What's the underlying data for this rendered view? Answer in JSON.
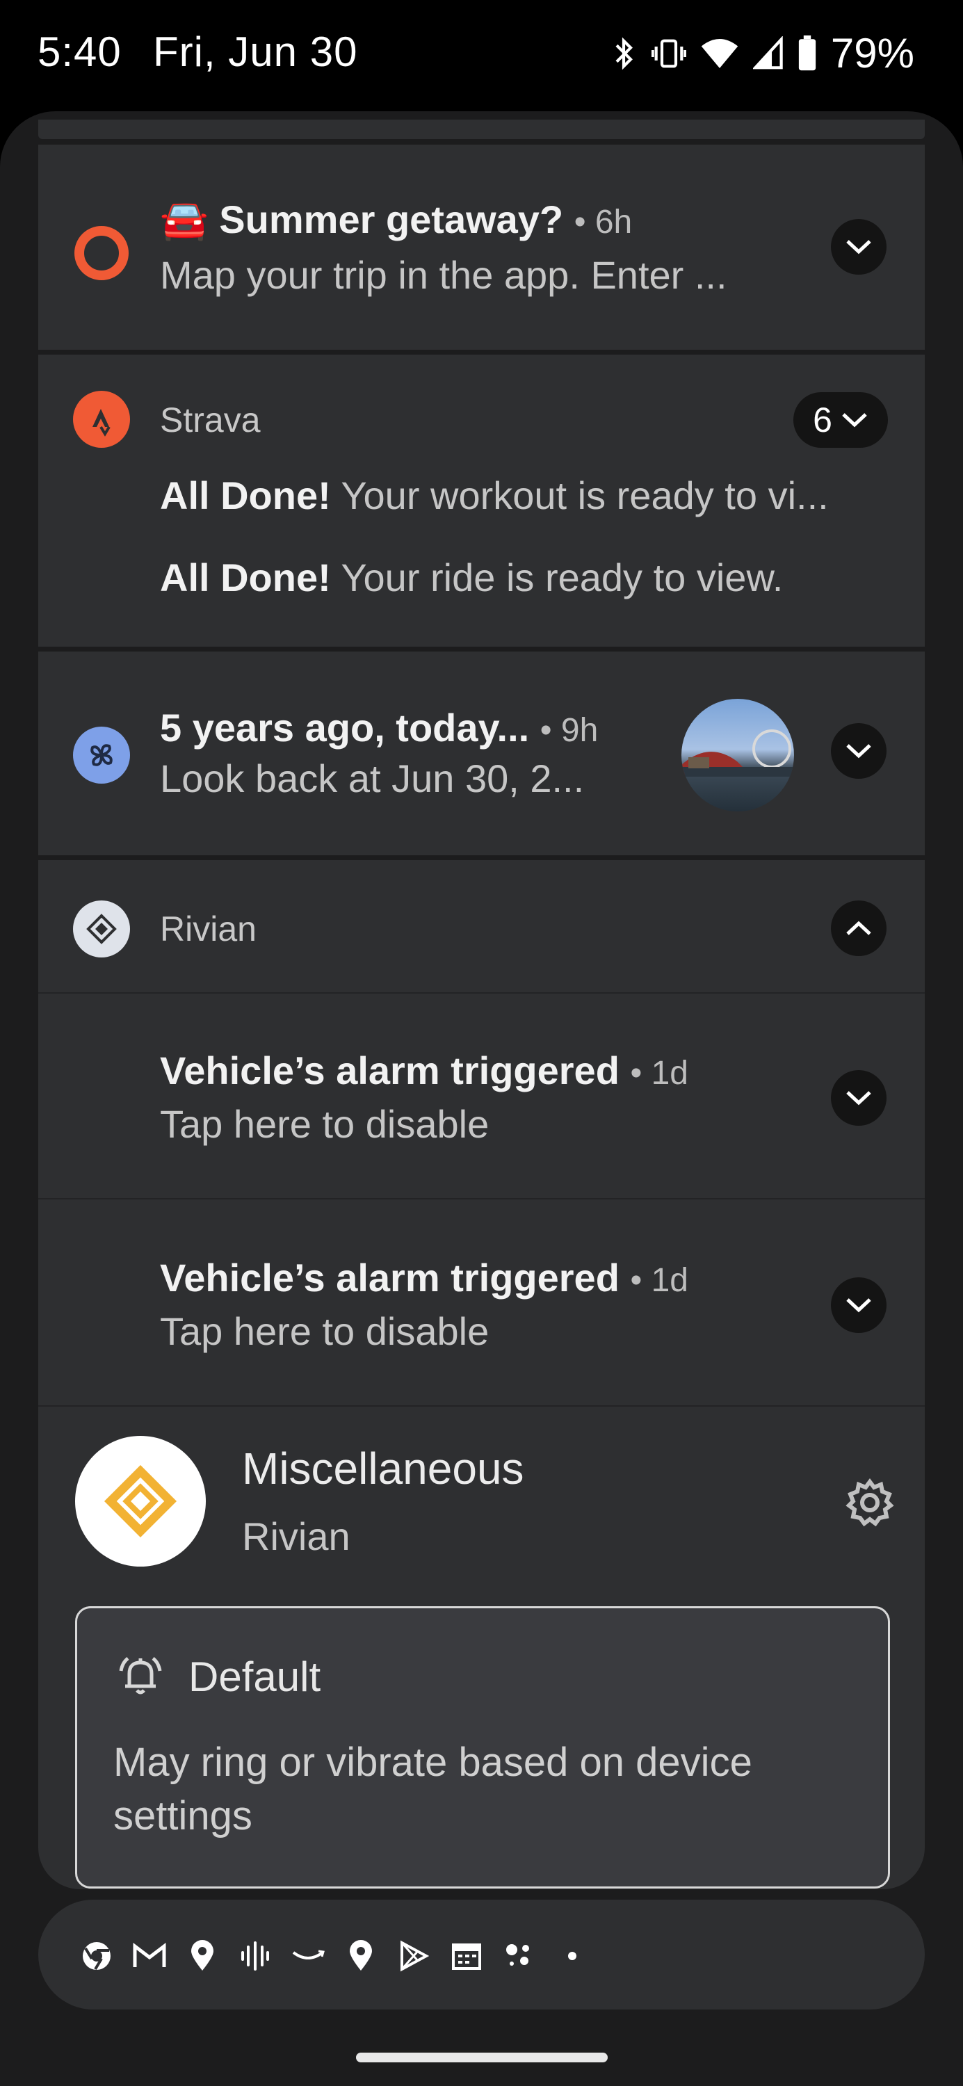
{
  "status_bar": {
    "time": "5:40",
    "date": "Fri, Jun 30",
    "battery": "79%",
    "icons": [
      "bluetooth-icon",
      "vibrate-icon",
      "wifi-icon",
      "signal-icon",
      "battery-icon"
    ]
  },
  "notifications": {
    "getaway": {
      "emoji": "🚘",
      "title": "Summer getaway?",
      "time": "• 6h",
      "body": "Map your trip in the app. Enter ..."
    },
    "strava": {
      "app": "Strava",
      "count": "6",
      "lines": [
        {
          "bold": "All Done!",
          "text": " Your workout is ready to vi..."
        },
        {
          "bold": "All Done!",
          "text": " Your ride is ready to view."
        }
      ]
    },
    "photos": {
      "title": "5 years ago, today...",
      "time": "• 9h",
      "body": "Look back at Jun 30, 2..."
    },
    "rivian": {
      "app": "Rivian",
      "items": [
        {
          "title": "Vehicle’s alarm triggered",
          "time": "• 1d",
          "body": "Tap here to disable"
        },
        {
          "title": "Vehicle’s alarm triggered",
          "time": "• 1d",
          "body": "Tap here to disable"
        }
      ],
      "channel": {
        "name": "Miscellaneous",
        "app": "Rivian",
        "default_label": "Default",
        "default_desc_line1": "May ring or vibrate based on device",
        "default_desc_line2": "settings"
      }
    }
  },
  "shelf": {
    "icons": [
      "chrome-icon",
      "gmail-icon",
      "maps-pin-icon",
      "podcast-icon",
      "amazon-icon",
      "maps-pin-icon",
      "play-store-icon",
      "calendar-icon",
      "assistant-icon",
      "more-dot-icon"
    ]
  },
  "colors": {
    "background": "#000000",
    "panel": "#1c1c1d",
    "card": "#2e2f31",
    "strava": "#f05a35",
    "photos": "#7ea0e8",
    "rivian_gold": "#f2b233"
  }
}
